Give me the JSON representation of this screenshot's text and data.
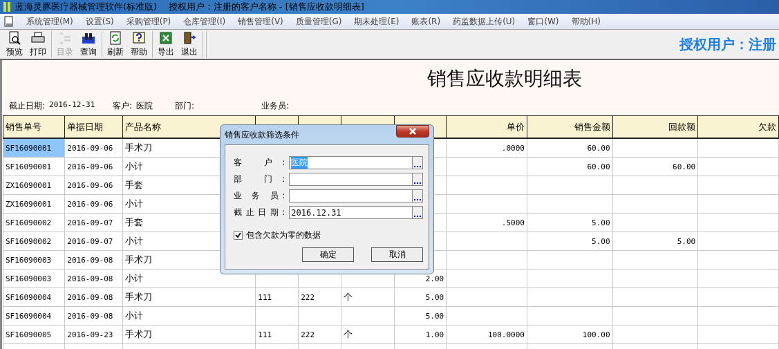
{
  "window": {
    "title": "蓝海灵豚医疗器械管理软件(标准版)    授权用户：注册的客户名称 - [销售应收款明细表]"
  },
  "menu": {
    "items": [
      "系统管理(M)",
      "设置(S)",
      "采购管理(P)",
      "仓库管理(I)",
      "销售管理(V)",
      "质量管理(G)",
      "期末处理(E)",
      "账表(R)",
      "药监数据上传(U)",
      "窗口(W)",
      "帮助(H)"
    ]
  },
  "toolbar": {
    "groups": [
      [
        {
          "kind": "preview",
          "label": "预览",
          "disabled": false
        },
        {
          "kind": "print",
          "label": "打印",
          "disabled": false
        }
      ],
      [
        {
          "kind": "tree",
          "label": "目录",
          "disabled": true
        },
        {
          "kind": "search",
          "label": "查询",
          "disabled": false
        }
      ],
      [
        {
          "kind": "refresh",
          "label": "刷新",
          "disabled": false
        },
        {
          "kind": "help",
          "label": "帮助",
          "disabled": false
        }
      ],
      [
        {
          "kind": "export",
          "label": "导出",
          "disabled": false
        },
        {
          "kind": "exit",
          "label": "退出",
          "disabled": false
        }
      ]
    ],
    "banner": "授权用户：注册"
  },
  "report": {
    "title": "销售应收款明细表",
    "filters": [
      {
        "label": "截止日期:",
        "value": "2016-12-31"
      },
      {
        "label": "客户:",
        "value": "医院"
      },
      {
        "label": "部门:"
      },
      {
        "label": "业务员:"
      }
    ],
    "table": {
      "columns": [
        "销售单号",
        "单据日期",
        "产品名称",
        null,
        null,
        null,
        null,
        "单价",
        "销售金额",
        "回款额",
        "欠款"
      ],
      "rows": [
        {
          "selected": true,
          "no": "SF16090001",
          "date": "2016-09-06",
          "product": "手术刀",
          "price": ".0000",
          "amount": "60.00"
        },
        {
          "selected": false,
          "no": "SF16090001",
          "date": "2016-09-06",
          "product": "小计",
          "amount": "60.00",
          "received": "60.00"
        },
        {
          "selected": false,
          "no": "ZX16090001",
          "date": "2016-09-06",
          "product": "手套"
        },
        {
          "selected": false,
          "no": "ZX16090001",
          "date": "2016-09-06",
          "product": "小计"
        },
        {
          "selected": false,
          "no": "SF16090002",
          "date": "2016-09-07",
          "product": "手套",
          "price": ".5000",
          "amount": "5.00"
        },
        {
          "selected": false,
          "no": "SF16090002",
          "date": "2016-09-07",
          "product": "小计",
          "amount": "5.00",
          "received": "5.00"
        },
        {
          "selected": false,
          "no": "SF16090003",
          "date": "2016-09-08",
          "product": "手术刀"
        },
        {
          "selected": false,
          "no": "SF16090003",
          "date": "2016-09-08",
          "product": "小计",
          "column_7": "2.00"
        },
        {
          "selected": false,
          "no": "SF16090004",
          "date": "2016-09-08",
          "product": "手术刀",
          "column_4": "111",
          "column_5": "222",
          "column_6": "个",
          "column_7": "5.00"
        },
        {
          "selected": false,
          "no": "SF16090004",
          "date": "2016-09-08",
          "product": "小计",
          "column_7": "5.00"
        },
        {
          "selected": false,
          "no": "SF16090005",
          "date": "2016-09-23",
          "product": "手术刀",
          "column_4": "111",
          "column_5": "222",
          "column_6": "个",
          "column_7": "1.00",
          "price": "100.0000",
          "amount": "100.00"
        },
        {
          "selected": false
        }
      ]
    }
  },
  "dialog": {
    "title": "销售应收款筛选条件",
    "fields": [
      {
        "label": "客 户:",
        "value": "医院",
        "selected": true
      },
      {
        "label": "部 门:",
        "selected": false
      },
      {
        "label": "业 务 员:",
        "selected": false
      },
      {
        "label": "截止日期:",
        "value": "2016.12.31",
        "selected": false
      }
    ],
    "checkbox": {
      "label": "包含欠款为零的数据",
      "checked": true
    },
    "buttons": [
      "确定",
      "取消"
    ]
  }
}
